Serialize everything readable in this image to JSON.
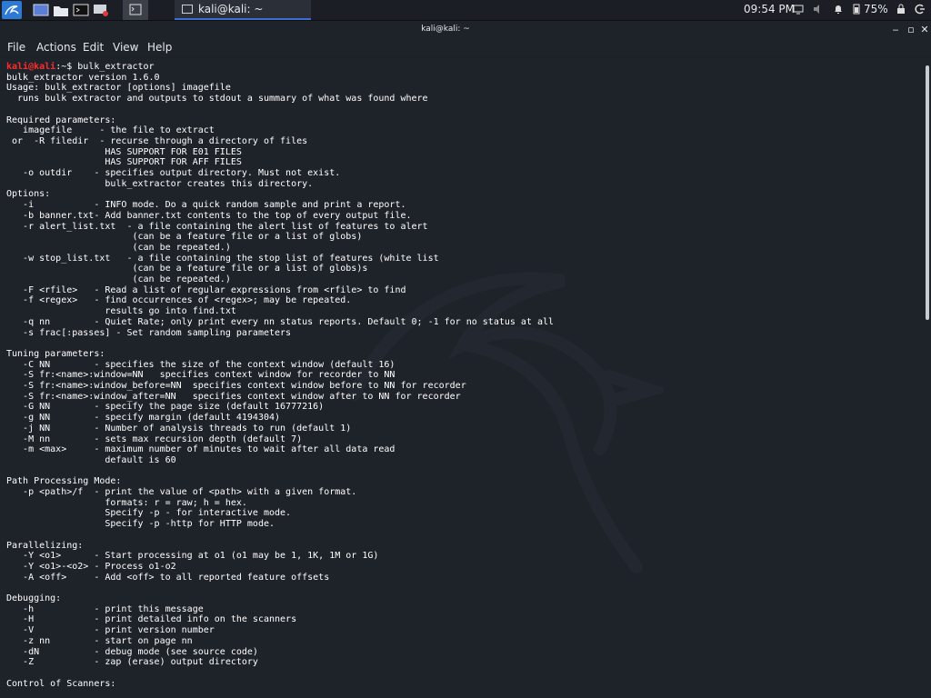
{
  "taskbar": {
    "window_title": "kali@kali: ~",
    "clock": "09:54 PM",
    "battery": "75%"
  },
  "window": {
    "title": "kali@kali: ~"
  },
  "menubar": {
    "file": "File",
    "actions": "Actions",
    "edit": "Edit",
    "view": "View",
    "help": "Help"
  },
  "terminal": {
    "prompt_user": "kali@kali",
    "prompt_sep": ":~$ ",
    "command": "bulk_extractor",
    "lines": [
      "bulk_extractor version 1.6.0",
      "Usage: bulk_extractor [options] imagefile",
      "  runs bulk extractor and outputs to stdout a summary of what was found where",
      "",
      "Required parameters:",
      "   imagefile     - the file to extract",
      " or  -R filedir  - recurse through a directory of files",
      "                  HAS SUPPORT FOR E01 FILES",
      "                  HAS SUPPORT FOR AFF FILES",
      "   -o outdir    - specifies output directory. Must not exist.",
      "                  bulk_extractor creates this directory.",
      "Options:",
      "   -i           - INFO mode. Do a quick random sample and print a report.",
      "   -b banner.txt- Add banner.txt contents to the top of every output file.",
      "   -r alert_list.txt  - a file containing the alert list of features to alert",
      "                       (can be a feature file or a list of globs)",
      "                       (can be repeated.)",
      "   -w stop_list.txt   - a file containing the stop list of features (white list",
      "                       (can be a feature file or a list of globs)s",
      "                       (can be repeated.)",
      "   -F <rfile>   - Read a list of regular expressions from <rfile> to find",
      "   -f <regex>   - find occurrences of <regex>; may be repeated.",
      "                  results go into find.txt",
      "   -q nn        - Quiet Rate; only print every nn status reports. Default 0; -1 for no status at all",
      "   -s frac[:passes] - Set random sampling parameters",
      "",
      "Tuning parameters:",
      "   -C NN        - specifies the size of the context window (default 16)",
      "   -S fr:<name>:window=NN   specifies context window for recorder to NN",
      "   -S fr:<name>:window_before=NN  specifies context window before to NN for recorder",
      "   -S fr:<name>:window_after=NN   specifies context window after to NN for recorder",
      "   -G NN        - specify the page size (default 16777216)",
      "   -g NN        - specify margin (default 4194304)",
      "   -j NN        - Number of analysis threads to run (default 1)",
      "   -M nn        - sets max recursion depth (default 7)",
      "   -m <max>     - maximum number of minutes to wait after all data read",
      "                  default is 60",
      "",
      "Path Processing Mode:",
      "   -p <path>/f  - print the value of <path> with a given format.",
      "                  formats: r = raw; h = hex.",
      "                  Specify -p - for interactive mode.",
      "                  Specify -p -http for HTTP mode.",
      "",
      "Parallelizing:",
      "   -Y <o1>      - Start processing at o1 (o1 may be 1, 1K, 1M or 1G)",
      "   -Y <o1>-<o2> - Process o1-o2",
      "   -A <off>     - Add <off> to all reported feature offsets",
      "",
      "Debugging:",
      "   -h           - print this message",
      "   -H           - print detailed info on the scanners",
      "   -V           - print version number",
      "   -z nn        - start on page nn",
      "   -dN          - debug mode (see source code)",
      "   -Z           - zap (erase) output directory",
      "",
      "Control of Scanners:"
    ]
  }
}
